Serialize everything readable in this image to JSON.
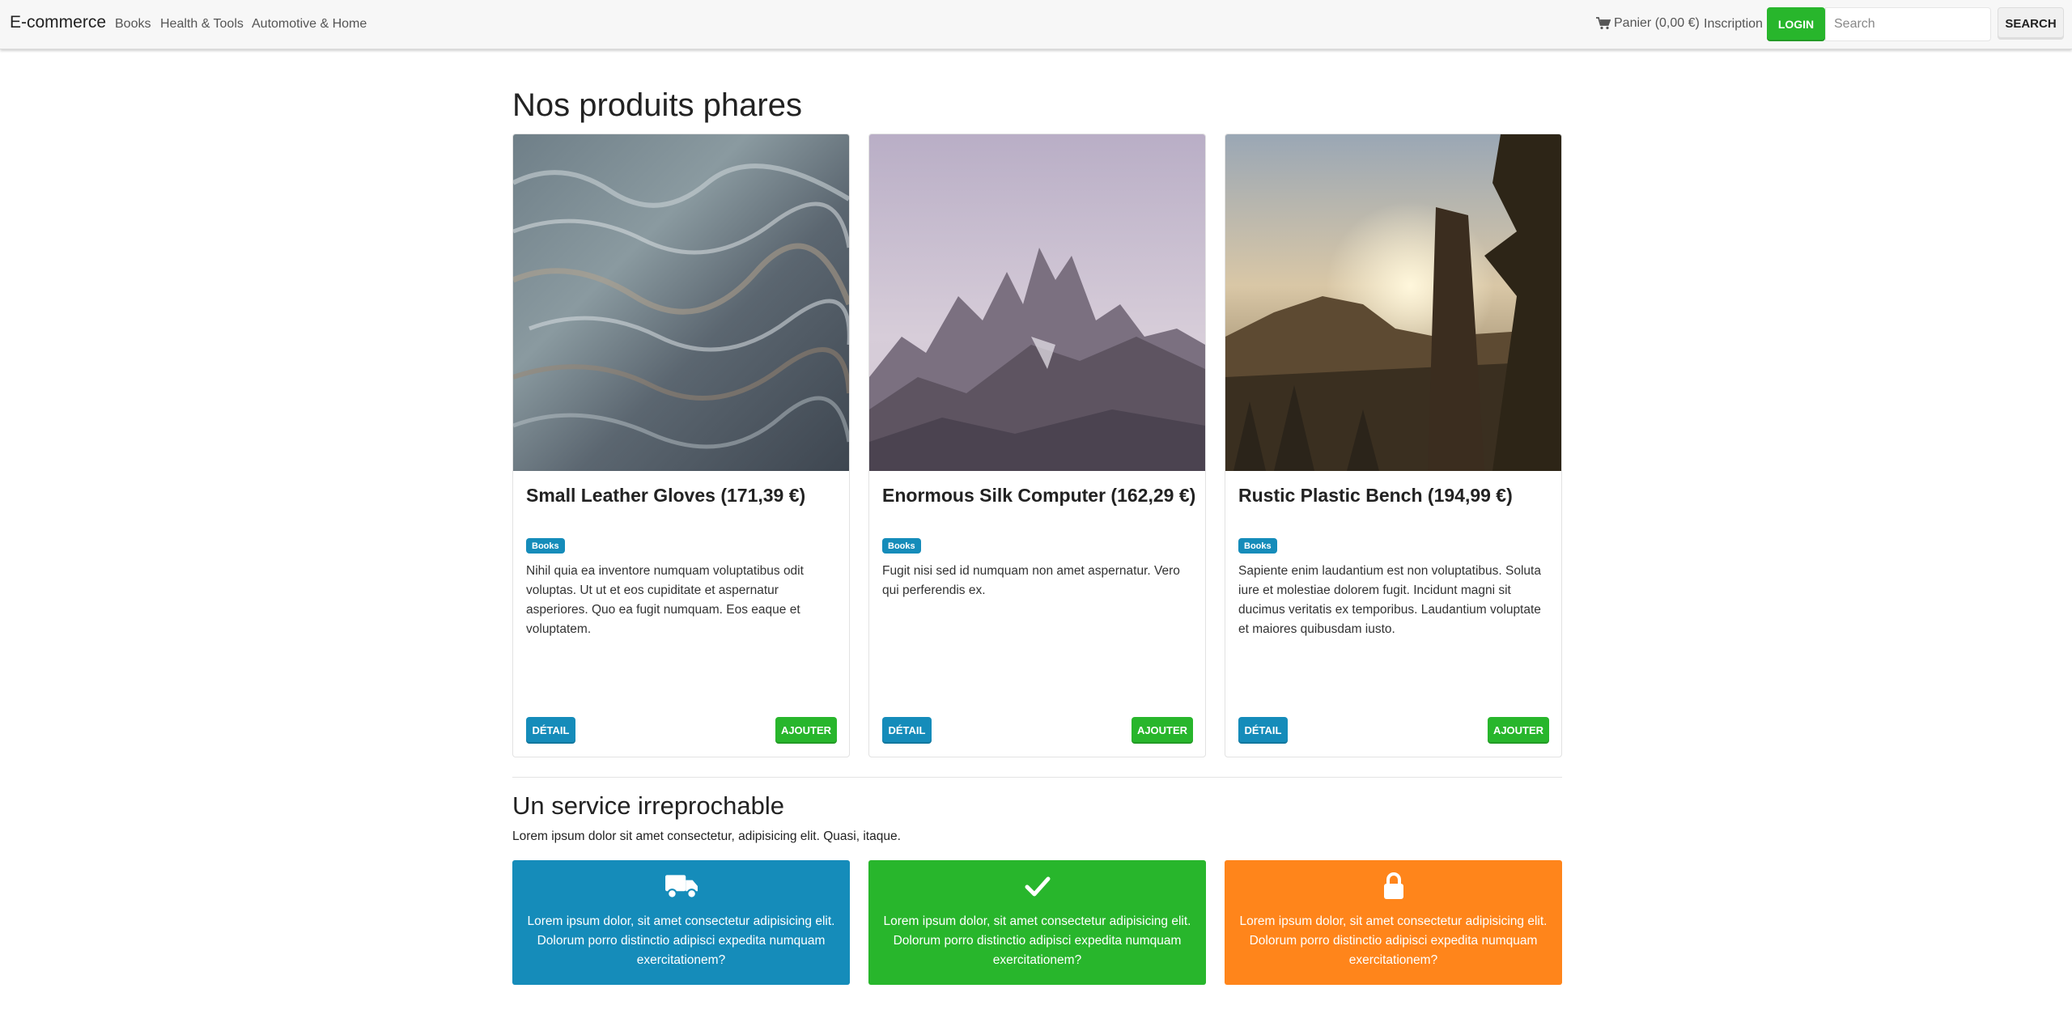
{
  "navbar": {
    "brand": "E-commerce",
    "links": [
      "Books",
      "Health & Tools",
      "Automotive & Home"
    ],
    "cart_label": "Panier (0,00 €)",
    "signup_label": "Inscription",
    "login_label": "Login",
    "search_placeholder": "Search",
    "search_button": "Search",
    "cart_icon": "shopping-cart-icon"
  },
  "featured": {
    "heading": "Nos produits phares",
    "products": [
      {
        "title": "Small Leather Gloves (171,39 €)",
        "badge": "Books",
        "description": "Nihil quia ea inventore numquam voluptatibus odit voluptas. Ut ut et eos cupiditate et aspernatur asperiores. Quo ea fugit numquam. Eos eaque et voluptatem.",
        "detail_label": "Détail",
        "add_label": "Ajouter"
      },
      {
        "title": "Enormous Silk Computer (162,29 €)",
        "badge": "Books",
        "description": "Fugit nisi sed id numquam non amet aspernatur. Vero qui perferendis ex.",
        "detail_label": "Détail",
        "add_label": "Ajouter"
      },
      {
        "title": "Rustic Plastic Bench (194,99 €)",
        "badge": "Books",
        "description": "Sapiente enim laudantium est non voluptatibus. Soluta iure et molestiae dolorem fugit. Incidunt magni sit ducimus veritatis ex temporibus. Laudantium voluptate et maiores quibusdam iusto.",
        "detail_label": "Détail",
        "add_label": "Ajouter"
      }
    ]
  },
  "service": {
    "heading": "Un service irreprochable",
    "lead": "Lorem ipsum dolor sit amet consectetur, adipisicing elit. Quasi, itaque.",
    "features": [
      {
        "icon": "truck-icon",
        "color": "#158cba",
        "text": "Lorem ipsum dolor, sit amet consectetur adipisicing elit. Dolorum porro distinctio adipisci expedita numquam exercitationem?"
      },
      {
        "icon": "check-icon",
        "color": "#28b62c",
        "text": "Lorem ipsum dolor, sit amet consectetur adipisicing elit. Dolorum porro distinctio adipisci expedita numquam exercitationem?"
      },
      {
        "icon": "lock-icon",
        "color": "#ff851b",
        "text": "Lorem ipsum dolor, sit amet consectetur adipisicing elit. Dolorum porro distinctio adipisci expedita numquam exercitationem?"
      }
    ]
  },
  "colors": {
    "primary": "#158cba",
    "success": "#28b62c",
    "warning": "#ff851b",
    "navbar_bg": "#f7f7f7"
  }
}
